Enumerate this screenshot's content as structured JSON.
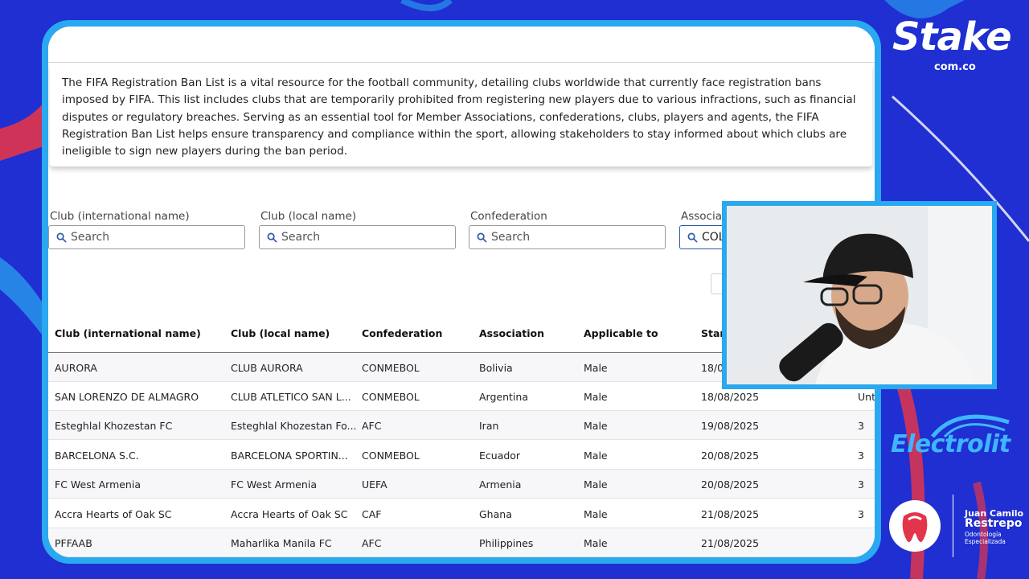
{
  "description": "The FIFA Registration Ban List is a vital resource for the football community, detailing clubs worldwide that currently face registration bans imposed by FIFA. This list includes clubs that are temporarily prohibited from registering new players due to various infractions, such as financial disputes or regulatory breaches. Serving as an essential tool for Member Associations, confederations, clubs, players and agents, the FIFA Registration Ban List helps ensure transparency and compliance within the sport, allowing stakeholders to stay informed about which clubs are ineligible to sign new players during the ban period.",
  "filters": [
    {
      "label": "Club (international name)",
      "placeholder": "Search",
      "icon": "search-icon"
    },
    {
      "label": "Club (local name)",
      "placeholder": "Search",
      "icon": "search-icon"
    },
    {
      "label": "Confederation",
      "placeholder": "Search",
      "icon": "search-icon"
    },
    {
      "label": "Associa",
      "value": "COL",
      "icon": "search-icon"
    }
  ],
  "table": {
    "headers": [
      "Club (international name)",
      "Club (local name)",
      "Confederation",
      "Association",
      "Applicable to",
      "Star"
    ],
    "rows": [
      [
        "AURORA",
        "CLUB AURORA",
        "CONMEBOL",
        "Bolivia",
        "Male",
        "18/0",
        ""
      ],
      [
        "SAN LORENZO DE ALMAGRO",
        "CLUB ATLETICO SAN L...",
        "CONMEBOL",
        "Argentina",
        "Male",
        "18/08/2025",
        "Unt"
      ],
      [
        "Esteghlal Khozestan FC",
        "Esteghlal Khozestan Fo...",
        "AFC",
        "Iran",
        "Male",
        "19/08/2025",
        "3"
      ],
      [
        "BARCELONA S.C.",
        "BARCELONA SPORTIN...",
        "CONMEBOL",
        "Ecuador",
        "Male",
        "20/08/2025",
        "3"
      ],
      [
        "FC West Armenia",
        "FC West Armenia",
        "UEFA",
        "Armenia",
        "Male",
        "20/08/2025",
        "3"
      ],
      [
        "Accra Hearts of Oak SC",
        "Accra Hearts of Oak SC",
        "CAF",
        "Ghana",
        "Male",
        "21/08/2025",
        "3"
      ],
      [
        "PFFAAB",
        "Maharlika Manila FC",
        "AFC",
        "Philippines",
        "Male",
        "21/08/2025",
        ""
      ]
    ]
  },
  "branding": {
    "stake": "Stake",
    "stake_domain": "com.co",
    "electrolit": "Electrolit",
    "clinic_name_1": "Juan Camilo",
    "clinic_name_2": "Restrepo",
    "clinic_sub_1": "Odontología",
    "clinic_sub_2": "Especializada"
  },
  "colors": {
    "background": "#1f2fd1",
    "panel_border": "#2aa8f0",
    "electrolit": "#3fb6ff"
  }
}
